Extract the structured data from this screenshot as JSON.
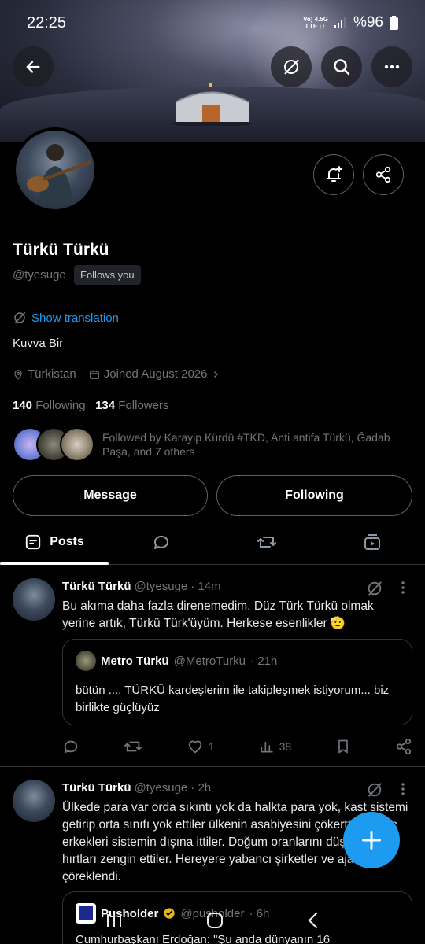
{
  "status_bar": {
    "time": "22:25",
    "network_top": "Vo) 4.5G",
    "network_bottom": "LTE ↓↑",
    "battery": "%96"
  },
  "profile": {
    "name": "Türkü Türkü",
    "handle": "@tyesuge",
    "follows_you": "Follows you",
    "translate_label": "Show translation",
    "bio": "Kuvva Bir",
    "location": "Türkistan",
    "joined": "Joined August 2026",
    "following_count": "140",
    "following_label": "Following",
    "followers_count": "134",
    "followers_label": "Followers",
    "followed_by": "Followed by Karayip Kürdü #TKD, Anti antifa Türkü, Ğadab Paşa, and 7 others"
  },
  "actions": {
    "message_label": "Message",
    "following_label": "Following"
  },
  "tabs": [
    {
      "label": "Posts",
      "icon": "posts-icon"
    },
    {
      "icon": "replies-icon"
    },
    {
      "icon": "reposts-icon"
    },
    {
      "icon": "media-icon"
    }
  ],
  "posts": [
    {
      "name": "Türkü Türkü",
      "handle": "@tyesuge",
      "time": "· 14m",
      "text": "Bu akıma daha fazla direnemedim. Düz Türk Türkü olmak yerine artık, Türkü Türk'üyüm. Herkese esenlikler 🫡",
      "quote": {
        "name": "Metro Türkü",
        "handle": "@MetroTurku",
        "time": "· 21h",
        "text": "bütün .... TÜRKÜ kardeşlerim ile takipleşmek istiyorum... biz birlikte güçlüyüz"
      },
      "likes": "1",
      "views": "38"
    },
    {
      "name": "Türkü Türkü",
      "handle": "@tyesuge",
      "time": "· 2h",
      "text": "Ülkede para var orda sıkıntı yok da halkta para yok, kast sistemi getirip orta sınıfı yok ettiler ülkenin asabiyesini çökerttiler genç erkekleri sistemin dışına ittiler. Doğum oranlarını düşürdüler, hırtları zengin ettiler. Hereyere yabancı şirketler ve ajanlar çöreklendi.",
      "quote": {
        "name": "Pusholder",
        "handle": "@pusholder",
        "time": "· 6h",
        "text": "Cumhurbaşkanı Erdoğan: \"Şu anda dünyanın 16"
      }
    }
  ],
  "colors": {
    "accent": "#1d9bf0",
    "background": "#000000",
    "muted": "#71767b",
    "border": "#2f3336"
  }
}
